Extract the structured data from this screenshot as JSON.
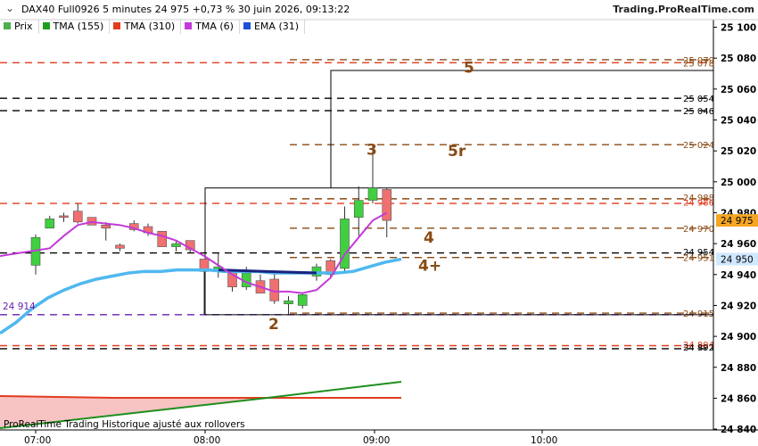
{
  "header": {
    "title": "DAX40 Full0926 5 minutes 24 975 +0,73 % 30 juin 2026, 09:13:22",
    "site": "Trading.ProRealTime.com",
    "chevron": "⌄"
  },
  "legend": [
    {
      "label": "Prix",
      "color": "#4caf50"
    },
    {
      "label": "TMA (155)",
      "color": "#1e9e1e"
    },
    {
      "label": "TMA (310)",
      "color": "#e23b1f"
    },
    {
      "label": "TMA (6)",
      "color": "#c23ad8"
    },
    {
      "label": "EMA (31)",
      "color": "#1a4fd6"
    }
  ],
  "price_axis": {
    "ticks": [
      "25 100",
      "25 080",
      "25 060",
      "25 040",
      "25 020",
      "25 000",
      "24 980",
      "24 960",
      "24 940",
      "24 920",
      "24 900",
      "24 880",
      "24 860",
      "24 840"
    ],
    "badges": [
      {
        "text": "24 975",
        "bg": "#f5a623"
      },
      {
        "text": "24 950",
        "bg": "#cfe8ff"
      }
    ]
  },
  "time_axis": [
    "07:00",
    "08:00",
    "09:00",
    "10:00"
  ],
  "level_labels": [
    {
      "text": "25 079",
      "color": "#8a4a14"
    },
    {
      "text": "25 078",
      "color": "#8a4a14"
    },
    {
      "text": "25 054",
      "color": "#000000"
    },
    {
      "text": "25 046",
      "color": "#000000"
    },
    {
      "text": "25 024",
      "color": "#8a4a14"
    },
    {
      "text": "24 988",
      "color": "#8a4a14"
    },
    {
      "text": "24 986",
      "color": "#e23b1f"
    },
    {
      "text": "24 970",
      "color": "#8a4a14"
    },
    {
      "text": "24 954",
      "color": "#000000"
    },
    {
      "text": "24 951",
      "color": "#8a4a14"
    },
    {
      "text": "24 915",
      "color": "#8a4a14"
    },
    {
      "text": "24 894",
      "color": "#e23b1f"
    },
    {
      "text": "24 892",
      "color": "#000000"
    }
  ],
  "chart_labels": {
    "label_5": "5",
    "label_3": "3",
    "label_5r": "5r",
    "label_4": "4",
    "label_4plus": "4+",
    "label_2": "2"
  },
  "left_level_label": "24 914",
  "footer_note": "ProRealTime Trading   Historique ajusté aux rollovers",
  "colors": {
    "up": "#3fcf3f",
    "down": "#f07070",
    "tma6": "#c23ad8",
    "ema31": "#4fb8f0",
    "ema_dark": "#1a237e",
    "brown": "#8a4a14",
    "red": "#e23b1f",
    "black": "#000000",
    "purple": "#6a1fb0"
  },
  "chart_data": {
    "type": "candlestick",
    "title": "DAX40 Full0926 5 minutes",
    "ylim": [
      24830,
      25105
    ],
    "x_ticks": [
      "07:00",
      "08:00",
      "09:00",
      "10:00"
    ],
    "candles": [
      {
        "o": 24946,
        "h": 24966,
        "l": 24940,
        "c": 24964
      },
      {
        "o": 24970,
        "h": 24978,
        "l": 24970,
        "c": 24976
      },
      {
        "o": 24978,
        "h": 24980,
        "l": 24974,
        "c": 24977
      },
      {
        "o": 24981,
        "h": 24986,
        "l": 24973,
        "c": 24974
      },
      {
        "o": 24977,
        "h": 24977,
        "l": 24972,
        "c": 24972
      },
      {
        "o": 24972,
        "h": 24974,
        "l": 24962,
        "c": 24970
      },
      {
        "o": 24959,
        "h": 24960,
        "l": 24955,
        "c": 24957
      },
      {
        "o": 24973,
        "h": 24975,
        "l": 24968,
        "c": 24969
      },
      {
        "o": 24971,
        "h": 24973,
        "l": 24965,
        "c": 24967
      },
      {
        "o": 24968,
        "h": 24968,
        "l": 24958,
        "c": 24958
      },
      {
        "o": 24958,
        "h": 24962,
        "l": 24955,
        "c": 24960
      },
      {
        "o": 24962,
        "h": 24962,
        "l": 24954,
        "c": 24956
      },
      {
        "o": 24950,
        "h": 24950,
        "l": 24914,
        "c": 24942
      },
      {
        "o": 24942,
        "h": 24954,
        "l": 24938,
        "c": 24945
      },
      {
        "o": 24942,
        "h": 24942,
        "l": 24929,
        "c": 24932
      },
      {
        "o": 24932,
        "h": 24945,
        "l": 24930,
        "c": 24941
      },
      {
        "o": 24936,
        "h": 24940,
        "l": 24928,
        "c": 24928
      },
      {
        "o": 24937,
        "h": 24942,
        "l": 24921,
        "c": 24923
      },
      {
        "o": 24921,
        "h": 24926,
        "l": 24914,
        "c": 24923
      },
      {
        "o": 24920,
        "h": 24928,
        "l": 24918,
        "c": 24927
      },
      {
        "o": 24939,
        "h": 24947,
        "l": 24936,
        "c": 24945
      },
      {
        "o": 24949,
        "h": 24950,
        "l": 24938,
        "c": 24940
      },
      {
        "o": 24944,
        "h": 24984,
        "l": 24942,
        "c": 24976
      },
      {
        "o": 24977,
        "h": 24997,
        "l": 24965,
        "c": 24988
      },
      {
        "o": 24988,
        "h": 25024,
        "l": 24986,
        "c": 24996
      },
      {
        "o": 24995,
        "h": 24996,
        "l": 24964,
        "c": 24975
      }
    ],
    "series": [
      {
        "name": "TMA (6)",
        "values": [
          24952,
          24957,
          24965,
          24972,
          24974,
          24973,
          24972,
          24970,
          24967,
          24965,
          24962,
          24957,
          24952,
          24946,
          24940,
          24935,
          24932,
          24929,
          24929,
          24928,
          24930,
          24938,
          24953,
          24964,
          24975,
          24980
        ]
      },
      {
        "name": "EMA (31)",
        "values": [
          24902,
          24909,
          24918,
          24925,
          24930,
          24934,
          24937,
          24939,
          24941,
          24942,
          24942,
          24943,
          24943,
          24943,
          24942,
          24942,
          24942,
          24941,
          24941,
          24941,
          24941,
          24941,
          24942,
          24945,
          24948,
          24950
        ]
      }
    ]
  }
}
